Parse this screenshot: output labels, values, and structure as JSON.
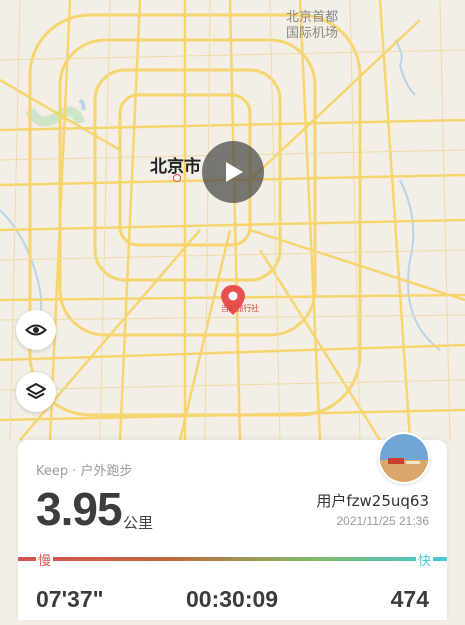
{
  "map": {
    "airport_label": "北京首都\n国际机场",
    "city_label": "北京市",
    "marker_label": "吉时旅行社"
  },
  "controls": {
    "play": "play-icon",
    "visibility": "eye-icon",
    "layers": "layers-icon"
  },
  "summary": {
    "source": "Keep · 户外跑步",
    "distance": "3.95",
    "distance_unit": "公里",
    "username": "用户fzw25uq63",
    "datetime": "2021/11/25 21:36",
    "slow_label": "慢",
    "fast_label": "快",
    "pace": "07'37\"",
    "duration": "00:30:09",
    "calories": "474"
  },
  "colors": {
    "slow": "#d9534f",
    "fast": "#48c9d9",
    "road": "#f6d56f"
  }
}
